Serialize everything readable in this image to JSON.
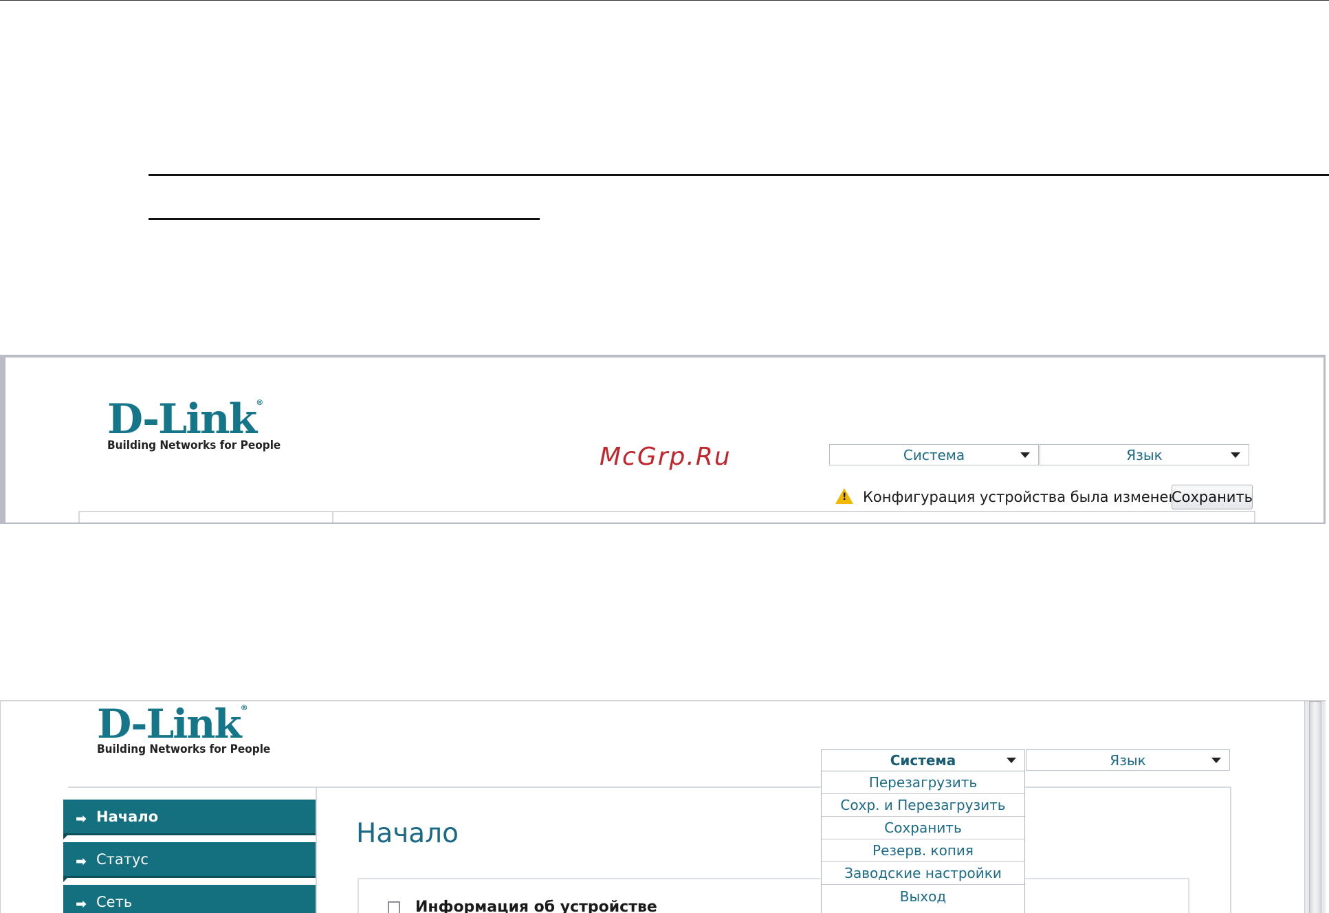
{
  "frame1": {
    "logo": {
      "brand": "D-Link",
      "registered": "®",
      "tagline": "Building Networks for People"
    },
    "watermark": "McGrp.Ru",
    "dropdowns": {
      "system": "Система",
      "language": "Язык"
    },
    "notice": {
      "warning_symbol": "!",
      "text": "Конфигурация устройства была изменена",
      "save_label": "Сохранить"
    }
  },
  "frame2": {
    "logo": {
      "brand": "D-Link",
      "registered": "®",
      "tagline": "Building Networks for People"
    },
    "dropdowns": {
      "system": "Система",
      "language": "Язык"
    },
    "system_menu": [
      {
        "label": "Перезагрузить"
      },
      {
        "label": "Сохр. и Перезагрузить"
      },
      {
        "label": "Сохранить"
      },
      {
        "label": "Резерв. копия"
      },
      {
        "label": "Заводские настройки"
      },
      {
        "label": "Выход"
      }
    ],
    "sidebar": [
      {
        "label": "Начало"
      },
      {
        "label": "Статус"
      },
      {
        "label": "Сеть"
      }
    ],
    "page_title": "Начало",
    "section_title": "Информация об устройстве"
  },
  "colors": {
    "brand": "#15768a",
    "sidebar": "#14707f",
    "link": "#1a6a86",
    "warning": "#f0b800",
    "watermark": "#c0262b"
  }
}
